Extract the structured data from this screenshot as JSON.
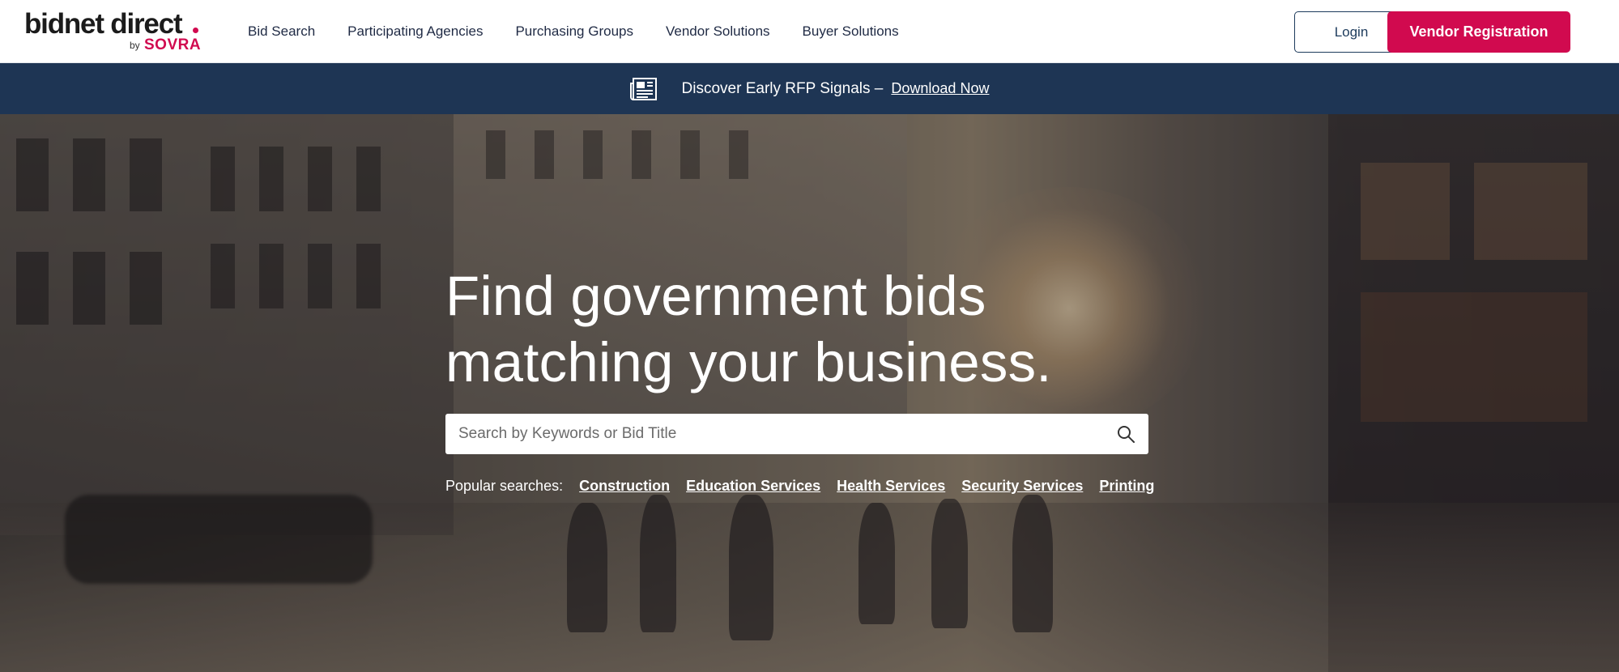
{
  "header": {
    "logo": {
      "main": "bidnet direct",
      "by": "by",
      "brand": "SOVRA"
    },
    "nav": [
      {
        "label": "Bid Search"
      },
      {
        "label": "Participating Agencies"
      },
      {
        "label": "Purchasing Groups"
      },
      {
        "label": "Vendor Solutions"
      },
      {
        "label": "Buyer Solutions"
      }
    ],
    "login_label": "Login",
    "register_label": "Vendor Registration"
  },
  "banner": {
    "icon": "newspaper-icon",
    "text": "Discover Early RFP Signals –",
    "link": "Download Now"
  },
  "hero": {
    "headline_line1": "Find government bids",
    "headline_line2": "matching your business.",
    "search": {
      "placeholder": "Search by Keywords or Bid Title",
      "icon": "search-icon"
    },
    "popular_label": "Popular searches:",
    "popular": [
      "Construction",
      "Education Services",
      "Health Services",
      "Security Services",
      "Printing"
    ]
  },
  "colors": {
    "brand": "#d10a4f",
    "banner_bg": "#1e3554",
    "login_border": "#1d3b5c"
  }
}
